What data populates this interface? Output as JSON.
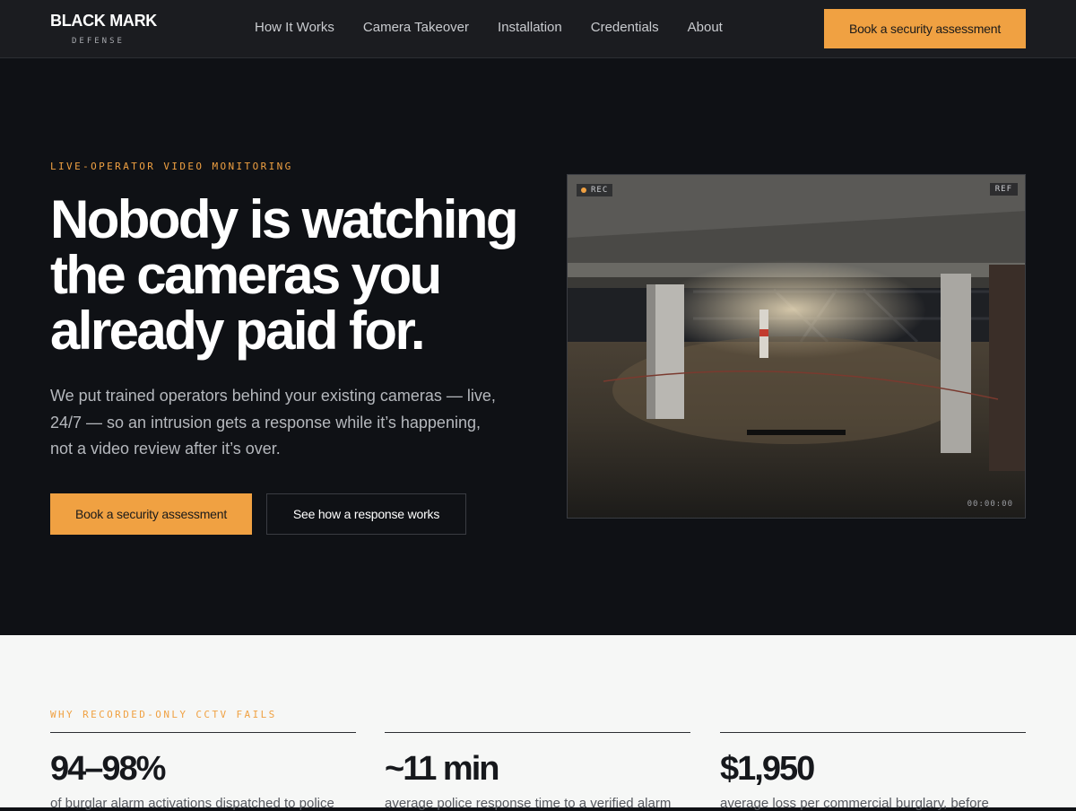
{
  "nav": {
    "logo_main": "BLACK MARK",
    "logo_sub": "DEFENSE",
    "links": [
      "How It Works",
      "Camera Takeover",
      "Installation",
      "Credentials",
      "About"
    ],
    "cta": "Book a security assessment"
  },
  "hero": {
    "eyebrow": "LIVE-OPERATOR VIDEO MONITORING",
    "title": "Nobody is watching the cameras you already paid for.",
    "subtitle": "We put trained operators behind your existing cameras — live, 24/7 — so an intrusion gets a response while it’s happening, not a video review after it’s over.",
    "primary_cta": "Book a security assessment",
    "secondary_cta": "See how a response works",
    "feed": {
      "rec_label": "REC",
      "ref_label": "REF",
      "timecode": "00:00:00"
    }
  },
  "stats": {
    "eyebrow": "WHY RECORDED-ONLY CCTV FAILS",
    "items": [
      {
        "value": "94–98%",
        "desc": "of burglar alarm activations dispatched to police"
      },
      {
        "value": "~11 min",
        "desc": "average police response time to a verified alarm"
      },
      {
        "value": "$1,950",
        "desc": "average loss per commercial burglary, before"
      }
    ]
  },
  "colors": {
    "accent": "#f0a142",
    "hero_bg": "#0f1115",
    "nav_bg": "#1b1c20",
    "stats_bg": "#f6f7f6"
  }
}
